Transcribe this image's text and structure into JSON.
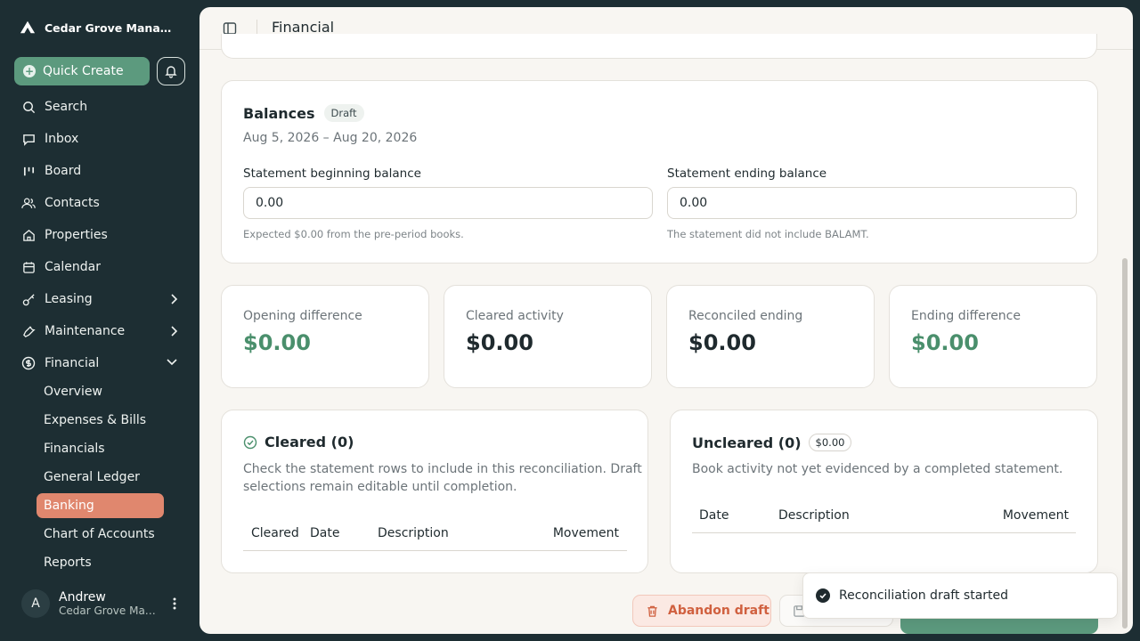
{
  "brand": {
    "name": "Cedar Grove Management"
  },
  "sidebar": {
    "quick_create": "Quick Create",
    "items": [
      {
        "label": "Search",
        "icon": "search-icon"
      },
      {
        "label": "Inbox",
        "icon": "inbox-icon"
      },
      {
        "label": "Board",
        "icon": "board-icon"
      },
      {
        "label": "Contacts",
        "icon": "contacts-icon"
      },
      {
        "label": "Properties",
        "icon": "home-icon"
      },
      {
        "label": "Calendar",
        "icon": "calendar-icon"
      },
      {
        "label": "Leasing",
        "icon": "key-icon"
      },
      {
        "label": "Maintenance",
        "icon": "wrench-icon"
      },
      {
        "label": "Financial",
        "icon": "dollar-icon"
      }
    ],
    "financial_sub": [
      {
        "label": "Overview"
      },
      {
        "label": "Expenses & Bills"
      },
      {
        "label": "Financials"
      },
      {
        "label": "General Ledger"
      },
      {
        "label": "Banking"
      },
      {
        "label": "Chart of Accounts"
      },
      {
        "label": "Reports"
      }
    ],
    "user": {
      "initial": "A",
      "name": "Andrew",
      "org": "Cedar Grove Management"
    }
  },
  "topbar": {
    "title": "Financial"
  },
  "balances": {
    "title": "Balances",
    "status": "Draft",
    "range": "Aug 5, 2026 – Aug 20, 2026",
    "beginning": {
      "label": "Statement beginning balance",
      "value": "0.00",
      "help": "Expected $0.00 from the pre-period books."
    },
    "ending": {
      "label": "Statement ending balance",
      "value": "0.00",
      "help": "The statement did not include BALAMT."
    }
  },
  "stats": [
    {
      "label": "Opening difference",
      "value": "$0.00"
    },
    {
      "label": "Cleared activity",
      "value": "$0.00"
    },
    {
      "label": "Reconciled ending",
      "value": "$0.00"
    },
    {
      "label": "Ending difference",
      "value": "$0.00"
    }
  ],
  "cleared": {
    "title": "Cleared (0)",
    "desc_line1": "Check the statement rows to include in this reconciliation. Draft",
    "desc_line2": "selections remain editable until completion.",
    "columns": [
      "Cleared",
      "Date",
      "Description",
      "Movement"
    ]
  },
  "uncleared": {
    "title": "Uncleared (0)",
    "amount": "$0.00",
    "desc": "Book activity not yet evidenced by a completed statement.",
    "columns": [
      "Date",
      "Description",
      "Movement"
    ]
  },
  "actions": {
    "abandon": "Abandon draft"
  },
  "toast": {
    "message": "Reconciliation draft started"
  },
  "colors": {
    "accent": "#5c9a7e",
    "active_nav": "#e0876e",
    "positive": "#4a8f6c",
    "danger": "#d0603f"
  }
}
